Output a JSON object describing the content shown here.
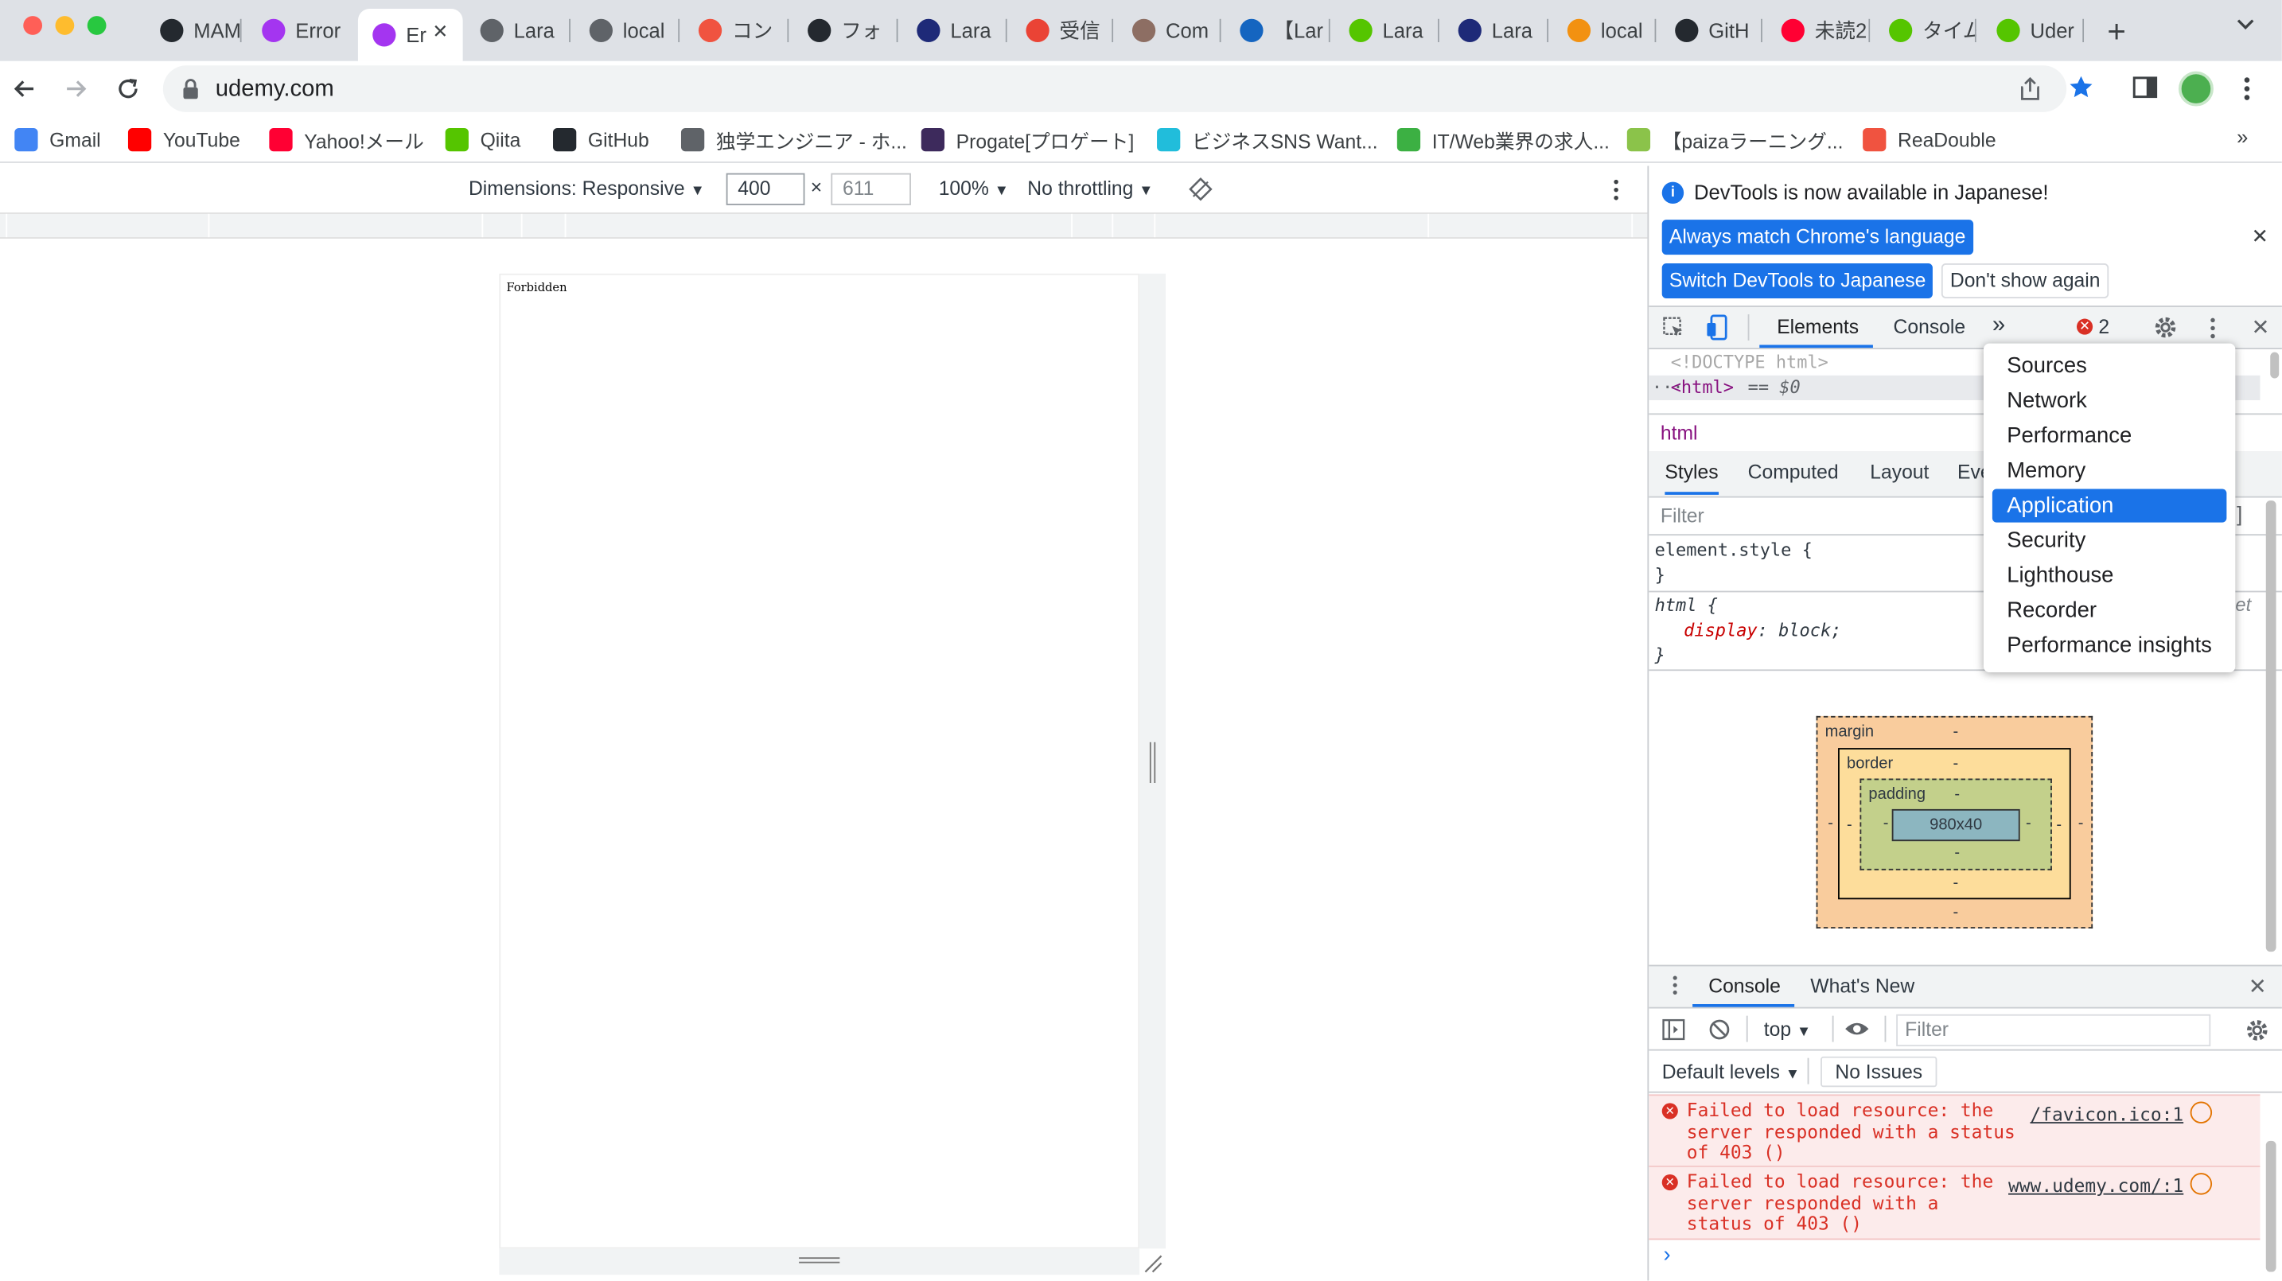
{
  "tabs": [
    {
      "label": "MAM",
      "icon": "github-icon"
    },
    {
      "label": "Error",
      "icon": "udemy-icon"
    },
    {
      "label": "Er",
      "icon": "udemy-icon"
    },
    {
      "label": "Lara",
      "icon": "globe-icon"
    },
    {
      "label": "local",
      "icon": "globe-icon"
    },
    {
      "label": "コン",
      "icon": "readouble-icon"
    },
    {
      "label": "フォ",
      "icon": "github-icon"
    },
    {
      "label": "Lara",
      "icon": "laravel-icon"
    },
    {
      "label": "受信",
      "icon": "gmail-icon"
    },
    {
      "label": "Com",
      "icon": "avatar-icon"
    },
    {
      "label": "【Lar",
      "icon": "cg-icon"
    },
    {
      "label": "Lara",
      "icon": "qiita-icon"
    },
    {
      "label": "Lara",
      "icon": "laravel-icon"
    },
    {
      "label": "local",
      "icon": "pma-icon"
    },
    {
      "label": "GitH",
      "icon": "github-icon"
    },
    {
      "label": "未読2",
      "icon": "yahoo-icon"
    },
    {
      "label": "タイム",
      "icon": "qiita-icon"
    },
    {
      "label": "Uder",
      "icon": "qiita-icon"
    }
  ],
  "address": {
    "url": "udemy.com"
  },
  "bookmarks": [
    {
      "label": "Gmail",
      "icon": "google-icon"
    },
    {
      "label": "YouTube",
      "icon": "youtube-icon"
    },
    {
      "label": "Yahoo!メール",
      "icon": "yahoo-icon"
    },
    {
      "label": "Qiita",
      "icon": "qiita-icon"
    },
    {
      "label": "GitHub",
      "icon": "github-icon"
    },
    {
      "label": "独学エンジニア - ホ...",
      "icon": "globe-icon"
    },
    {
      "label": "Progate[プロゲート]",
      "icon": "progate-icon"
    },
    {
      "label": "ビジネスSNS Want...",
      "icon": "wantedly-icon"
    },
    {
      "label": "IT/Web業界の求人...",
      "icon": "green-icon"
    },
    {
      "label": "【paizaラーニング...",
      "icon": "paiza-icon"
    },
    {
      "label": "ReaDouble",
      "icon": "readouble-icon"
    }
  ],
  "device_toolbar": {
    "dimensions": "Dimensions: Responsive",
    "width": "400",
    "times": "×",
    "height": "611",
    "zoom": "100%",
    "throttling": "No throttling"
  },
  "page": {
    "body_text": "Forbidden"
  },
  "devtools": {
    "banner_text": "DevTools is now available in Japanese!",
    "btn_match": "Always match Chrome's language",
    "btn_switch": "Switch DevTools to Japanese",
    "btn_dont_show": "Don't show again",
    "tab_elements": "Elements",
    "tab_console": "Console",
    "error_count": "2",
    "dom_doctype": "<!DOCTYPE html>",
    "dom_html": "<html>",
    "dom_eq": "== $0",
    "breadcrumb": "html",
    "subtabs": [
      "Styles",
      "Computed",
      "Layout",
      "Eve"
    ],
    "filter_placeholder": "Filter",
    "rule1_selector": "element.style {",
    "rule1_close": "}",
    "rule2_selector": "html {",
    "rule2_prop": "display",
    "rule2_value": "block;",
    "rule2_close": "}",
    "rule2_source": "et",
    "more_tabs_menu": [
      "Sources",
      "Network",
      "Performance",
      "Memory",
      "Application",
      "Security",
      "Lighthouse",
      "Recorder",
      "Performance insights"
    ],
    "selected_menu_item": "Application",
    "box_model": {
      "margin": "margin",
      "border": "border",
      "padding": "padding",
      "content": "980x40",
      "dash": "-"
    },
    "drawer_tabs": [
      "Console",
      "What's New"
    ],
    "context": "top",
    "console_filter_placeholder": "Filter",
    "levels": "Default levels",
    "issues": "No Issues",
    "messages": [
      {
        "text": "Failed to load resource: the server responded with a status of 403 ()",
        "lines": [
          "Failed to load resource: the",
          "server responded with a status",
          "of 403 ()"
        ],
        "source": "/favicon.ico:1"
      },
      {
        "text": "Failed to load resource: the server responded with a status of 403 ()",
        "lines": [
          "Failed to load resource: the",
          "server responded with a",
          "status of 403 ()"
        ],
        "source": "www.udemy.com/:1"
      }
    ],
    "prompt": "›"
  },
  "colors": {
    "accent": "#1a73e8",
    "error": "#d93025",
    "tabstrip": "#dee1e6",
    "margin_box": "#f9cc9d",
    "border_box": "#fddd9b",
    "padding_box": "#c3d08b",
    "content_box": "#8cb6c0"
  }
}
